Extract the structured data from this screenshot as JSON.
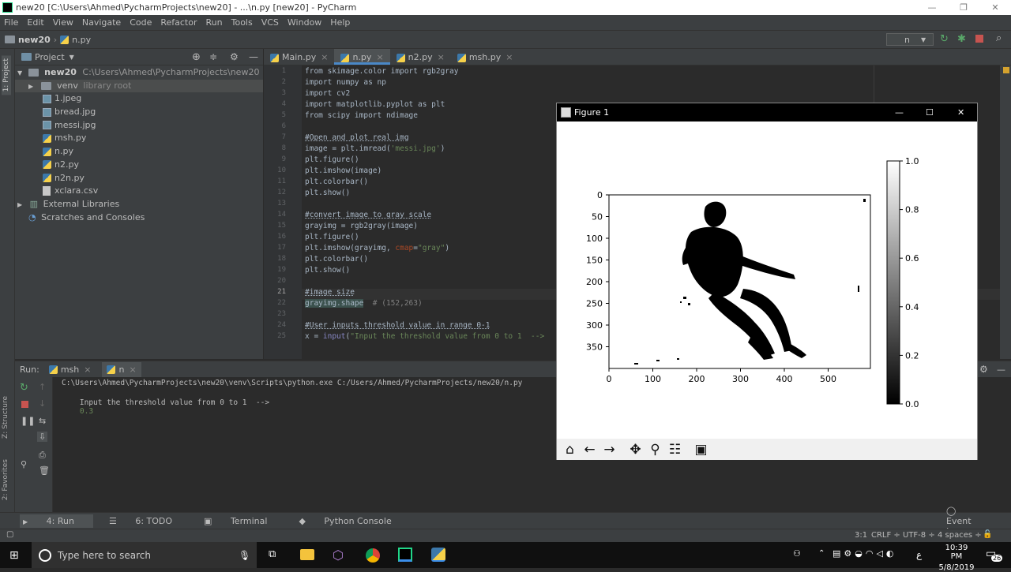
{
  "window": {
    "title": "new20 [C:\\Users\\Ahmed\\PycharmProjects\\new20] - ...\\n.py [new20] - PyCharm",
    "controls": [
      "—",
      "❐",
      "✕"
    ]
  },
  "menu": [
    "File",
    "Edit",
    "View",
    "Navigate",
    "Code",
    "Refactor",
    "Run",
    "Tools",
    "VCS",
    "Window",
    "Help"
  ],
  "nav": {
    "crumb1": "new20",
    "crumb2": "n.py",
    "run_config": "n"
  },
  "project": {
    "header": "Project",
    "root": "new20",
    "root_path": "C:\\Users\\Ahmed\\PycharmProjects\\new20",
    "venv": "venv",
    "venv_note": "library root",
    "files": [
      "1.jpeg",
      "bread.jpg",
      "messi.jpg",
      "msh.py",
      "n.py",
      "n2.py",
      "n2n.py",
      "xclara.csv"
    ],
    "external": "External Libraries",
    "scratches": "Scratches and Consoles"
  },
  "side_labels": {
    "project": "1: Project",
    "structure": "Z: Structure",
    "favorites": "2: Favorites"
  },
  "tabs": [
    "Main.py",
    "n.py",
    "n2.py",
    "msh.py"
  ],
  "code": {
    "l1": "from skimage.color import rgb2gray",
    "l2": "import numpy as np",
    "l3": "import cv2",
    "l4": "import matplotlib.pyplot as plt",
    "l5": "from scipy import ndimage",
    "l7": "#Open and plot real img",
    "l8a": "image = plt.imread(",
    "l8b": "'messi.jpg'",
    "l8c": ")",
    "l9": "plt.figure()",
    "l10": "plt.imshow(image)",
    "l11": "plt.colorbar()",
    "l12": "plt.show()",
    "l14": "#convert image to gray scale",
    "l15": "grayimg = rgb2gray(image)",
    "l16": "plt.figure()",
    "l17a": "plt.imshow(grayimg, ",
    "l17b": "cmap",
    "l17c": "=",
    "l17d": "\"gray\"",
    "l17e": ")",
    "l18": "plt.colorbar()",
    "l19": "plt.show()",
    "l21": "#image size",
    "l22a": "grayimg.shape",
    "l22b": "  # (152,263)",
    "l24": "#User inputs threshold value in range 0-1",
    "l25a": "x = ",
    "l25b": "input",
    "l25c": "(",
    "l25d": "\"Input the threshold value from 0 to 1  -->"
  },
  "line_numbers": [
    "1",
    "2",
    "3",
    "4",
    "5",
    "6",
    "7",
    "8",
    "9",
    "10",
    "11",
    "12",
    "13",
    "14",
    "15",
    "16",
    "17",
    "18",
    "19",
    "20",
    "21",
    "22",
    "23",
    "24",
    "25"
  ],
  "run": {
    "label": "Run:",
    "tab1": "msh",
    "tab2": "n",
    "cmd": "C:\\Users\\Ahmed\\PycharmProjects\\new20\\venv\\Scripts\\python.exe C:/Users/Ahmed/PycharmProjects/new20/n.py",
    "prompt": "Input the threshold value from 0 to 1  -->",
    "input_value": "0.3"
  },
  "bottom_tabs": [
    "4: Run",
    "6: TODO",
    "Terminal",
    "Python Console"
  ],
  "event_log": "Event Log",
  "status": {
    "pos": "3:1",
    "crlf": "CRLF ÷",
    "enc": "UTF-8 ÷",
    "indent": "4 spaces ÷"
  },
  "figure": {
    "title": "Figure 1",
    "controls": [
      "—",
      "☐",
      "✕"
    ]
  },
  "chart_data": [
    {
      "type": "image",
      "x_ticks": [
        "0",
        "100",
        "200",
        "300",
        "400",
        "500"
      ],
      "y_ticks": [
        "0",
        "50",
        "100",
        "150",
        "200",
        "250",
        "300",
        "350"
      ],
      "xlim": [
        0,
        600
      ],
      "ylim": [
        400,
        0
      ]
    },
    {
      "type": "colorbar",
      "ticks": [
        "0.0",
        "0.2",
        "0.4",
        "0.6",
        "0.8",
        "1.0"
      ],
      "range": [
        0,
        1
      ],
      "colors": [
        "#000000",
        "#ffffff"
      ]
    }
  ],
  "taskbar": {
    "search_placeholder": "Type here to search",
    "time": "10:39 PM",
    "date": "5/8/2019",
    "lang": "ع",
    "notif_count": "26"
  }
}
